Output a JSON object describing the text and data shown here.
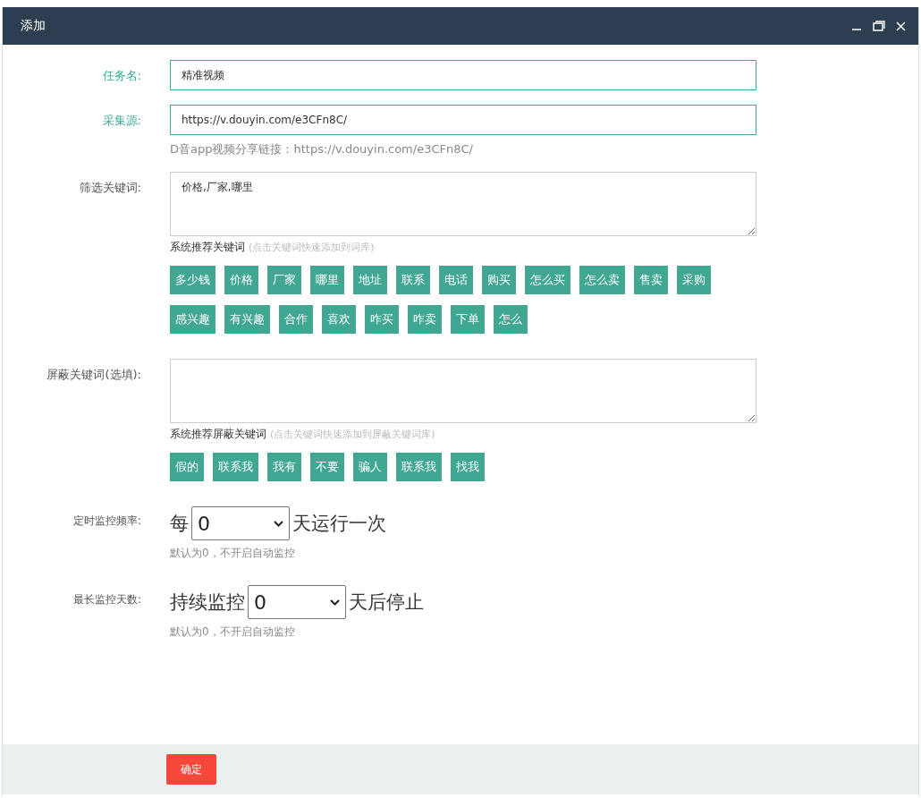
{
  "window": {
    "title": "添加"
  },
  "form": [
    {
      "kind": "input",
      "label": "任务名:",
      "value": "精准视频",
      "highlighted": true
    },
    {
      "kind": "input",
      "label": "采集源:",
      "value": "https://v.douyin.com/e3CFn8C/",
      "highlighted": true,
      "hint": "D音app视频分享链接：https://v.douyin.com/e3CFn8C/"
    },
    {
      "kind": "textarea",
      "label": "筛选关键词:",
      "value": "价格,厂家,哪里",
      "highlighted": false,
      "suggest_title": "系统推荐关键词",
      "suggest_note": "(点击关键词快速添加到词库)",
      "tags": [
        "多少钱",
        "价格",
        "厂家",
        "哪里",
        "地址",
        "联系",
        "电话",
        "购买",
        "怎么买",
        "怎么卖",
        "售卖",
        "采购",
        "感兴趣",
        "有兴趣",
        "合作",
        "喜欢",
        "咋买",
        "咋卖",
        "下单",
        "怎么"
      ]
    },
    {
      "kind": "textarea",
      "label": "屏蔽关键词(选填):",
      "highlighted": false,
      "suggest_title": "系统推荐屏蔽关键词",
      "suggest_note": "(点击关键词快速添加到屏蔽关键词库)",
      "tags": [
        "假的",
        "联系我",
        "我有",
        "不要",
        "骗人",
        "联系我",
        "找我"
      ]
    },
    {
      "kind": "select",
      "label": "定时监控频率:",
      "prefix": "每",
      "value": "0",
      "suffix": "天运行一次",
      "hint": "默认为0，不开启自动监控"
    },
    {
      "kind": "select",
      "label": "最长监控天数:",
      "prefix": "持续监控",
      "value": "0",
      "suffix": "天后停止",
      "hint": "默认为0，不开启自动监控"
    }
  ],
  "footer": {
    "button": "确定"
  }
}
